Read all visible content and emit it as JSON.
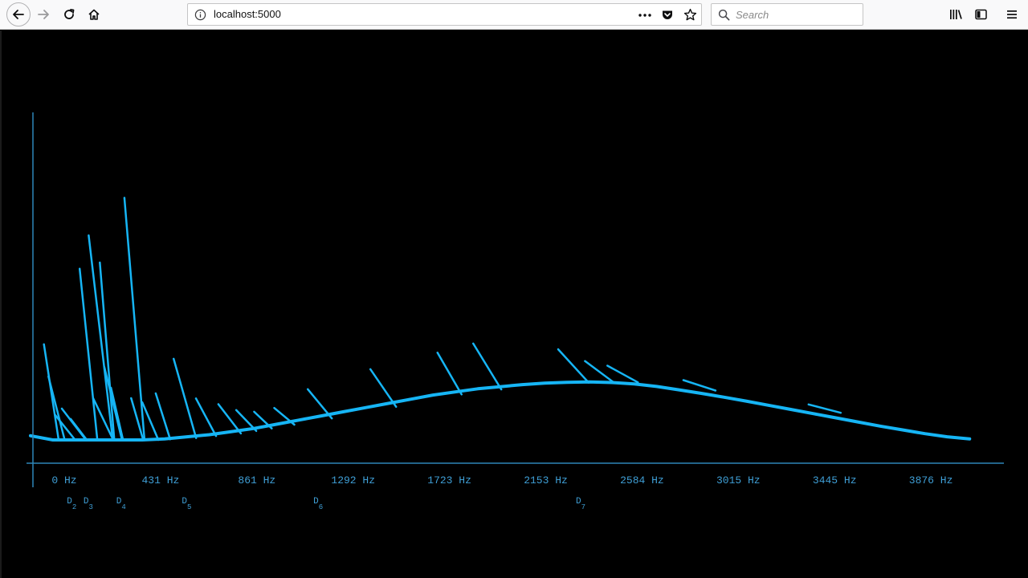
{
  "browser": {
    "url": "localhost:5000",
    "search_placeholder": "Search"
  },
  "chart_data": {
    "type": "line",
    "xlabel": "",
    "ylabel": "",
    "tick_labels": [
      "0 Hz",
      "431 Hz",
      "861 Hz",
      "1292 Hz",
      "1723 Hz",
      "2153 Hz",
      "2584 Hz",
      "3015 Hz",
      "3445 Hz",
      "3876 Hz"
    ],
    "x_unit": "Hz",
    "xlim": [
      0,
      4250
    ],
    "note_markers": [
      {
        "letter": "D",
        "octave": "2",
        "freq": 73
      },
      {
        "letter": "D",
        "octave": "3",
        "freq": 147
      },
      {
        "letter": "D",
        "octave": "4",
        "freq": 294
      },
      {
        "letter": "D",
        "octave": "5",
        "freq": 587
      },
      {
        "letter": "D",
        "octave": "6",
        "freq": 1175
      },
      {
        "letter": "D",
        "octave": "7",
        "freq": 2349
      }
    ],
    "series": [
      {
        "line_color": "#16b5f5",
        "x": [
          0,
          100,
          200,
          300,
          400,
          500,
          600,
          700,
          800,
          900,
          1000,
          1100,
          1200,
          1300,
          1400,
          1500,
          1600,
          1700,
          1800,
          1900,
          2000,
          2100,
          2200,
          2300,
          2400,
          2500,
          2600,
          2700,
          2800,
          2900,
          3000,
          3100,
          3200,
          3300,
          3400,
          3500,
          3600,
          3700,
          3800,
          3900,
          4000,
          4100,
          4200
        ],
        "values": [
          2,
          0,
          0,
          0,
          0,
          0,
          0.5,
          1.5,
          2.5,
          4,
          5.5,
          7.5,
          9.5,
          11.5,
          13.5,
          15.5,
          17.5,
          19.5,
          21.5,
          23,
          24.5,
          25.5,
          26.5,
          27.2,
          27.6,
          27.8,
          27.5,
          26.8,
          25.6,
          24,
          22.3,
          20.5,
          18.6,
          16.6,
          14.6,
          12.6,
          10.6,
          8.6,
          6.6,
          4.8,
          3,
          1.5,
          0.5
        ]
      }
    ],
    "spikes": [
      {
        "freq": 60,
        "peak": 45,
        "lean": 18
      },
      {
        "freq": 80,
        "peak": 30,
        "lean": 20
      },
      {
        "freq": 110,
        "peak": 12,
        "lean": 25
      },
      {
        "freq": 140,
        "peak": 15,
        "lean": 30
      },
      {
        "freq": 180,
        "peak": 10,
        "lean": 20
      },
      {
        "freq": 220,
        "peak": 82,
        "lean": 22
      },
      {
        "freq": 260,
        "peak": 98,
        "lean": 30
      },
      {
        "freq": 280,
        "peak": 20,
        "lean": 25
      },
      {
        "freq": 310,
        "peak": 85,
        "lean": 18
      },
      {
        "freq": 330,
        "peak": 35,
        "lean": 22
      },
      {
        "freq": 360,
        "peak": 25,
        "lean": 15
      },
      {
        "freq": 420,
        "peak": 116,
        "lean": 25
      },
      {
        "freq": 450,
        "peak": 20,
        "lean": 15
      },
      {
        "freq": 500,
        "peak": 18,
        "lean": 20
      },
      {
        "freq": 560,
        "peak": 22,
        "lean": 18
      },
      {
        "freq": 640,
        "peak": 38,
        "lean": 28
      },
      {
        "freq": 740,
        "peak": 18,
        "lean": 25
      },
      {
        "freq": 840,
        "peak": 14,
        "lean": 28
      },
      {
        "freq": 920,
        "peak": 10,
        "lean": 25
      },
      {
        "freq": 1000,
        "peak": 8,
        "lean": 22
      },
      {
        "freq": 1090,
        "peak": 8,
        "lean": 25
      },
      {
        "freq": 1240,
        "peak": 14,
        "lean": 30
      },
      {
        "freq": 1520,
        "peak": 18,
        "lean": 32
      },
      {
        "freq": 1820,
        "peak": 20,
        "lean": 30
      },
      {
        "freq": 1980,
        "peak": 22,
        "lean": 35
      },
      {
        "freq": 2360,
        "peak": 16,
        "lean": 38
      },
      {
        "freq": 2480,
        "peak": 10,
        "lean": 35
      },
      {
        "freq": 2580,
        "peak": 8,
        "lean": 38
      },
      {
        "freq": 2920,
        "peak": 5,
        "lean": 40
      },
      {
        "freq": 3480,
        "peak": 4,
        "lean": 40
      }
    ]
  }
}
